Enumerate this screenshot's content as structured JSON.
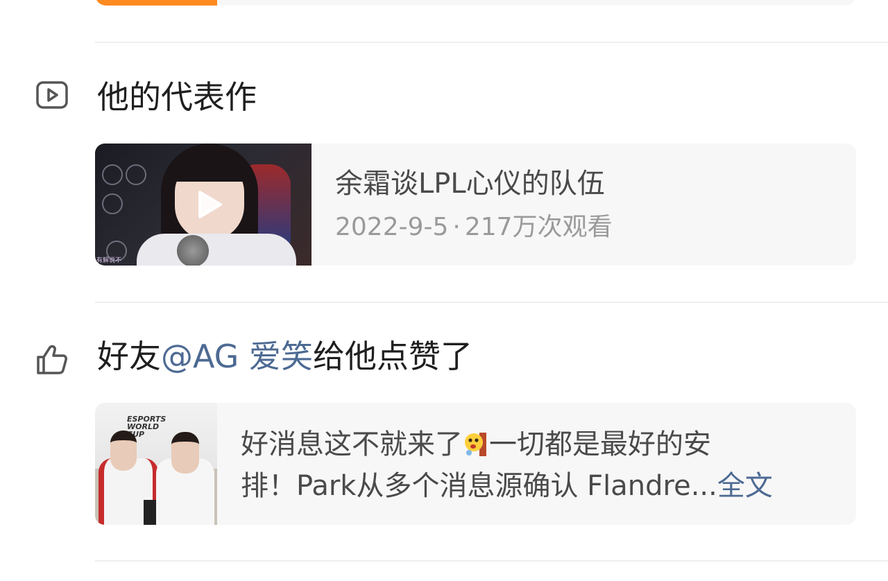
{
  "colors": {
    "accent_orange": "#ff8a1f",
    "mention_blue": "#4d6a93",
    "card_bg": "#f7f7f7",
    "meta_gray": "#9a9a9a"
  },
  "representative_section": {
    "icon": "video-play-icon",
    "title": "他的代表作",
    "video": {
      "title": "余霜谈LPL心仪的队伍",
      "date": "2022-9-5",
      "separator": "·",
      "views": "217万次观看",
      "thumbnail_watermark": "有解说不"
    }
  },
  "liked_section": {
    "icon": "thumbs-up-icon",
    "title_prefix": "好友",
    "mention": "@AG 爱笑",
    "title_suffix": "给他点赞了",
    "post": {
      "line1_before_emoji": "好消息这不就来了",
      "emoji": "peeking-emoji",
      "line1_after_emoji": "一切都是最好的安",
      "line2": "排！Park从多个消息源确认 Flandre...",
      "read_more": "全文",
      "thumbnail_logo": "ESPORTS WORLD CUP"
    }
  }
}
